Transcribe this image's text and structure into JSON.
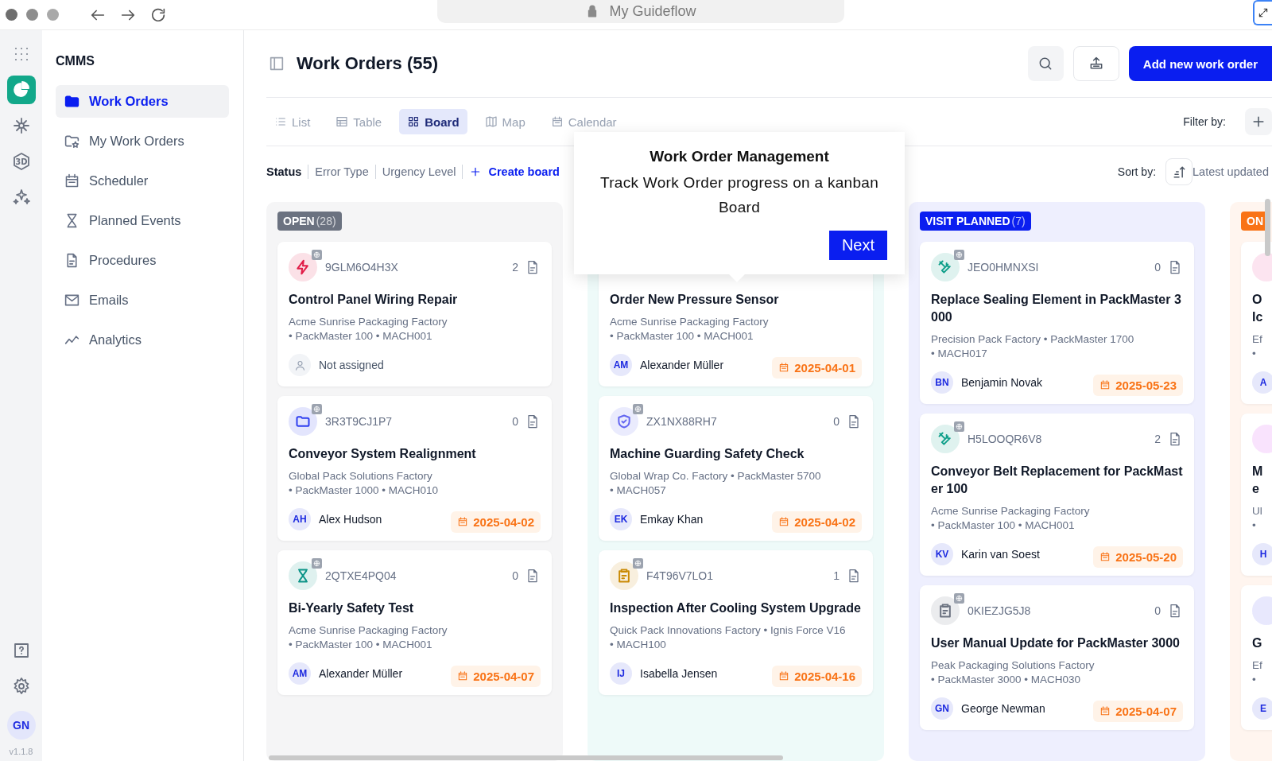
{
  "browser": {
    "address": "My Guideflow"
  },
  "rail": {
    "items": [
      {
        "kind": "grid",
        "selected": false
      },
      {
        "kind": "pie",
        "selected": true
      },
      {
        "kind": "network",
        "selected": false
      },
      {
        "kind": "cube",
        "label": "3D",
        "selected": false
      },
      {
        "kind": "sparkles",
        "selected": false
      }
    ],
    "bottom_items": [
      {
        "kind": "help"
      },
      {
        "kind": "settings"
      }
    ],
    "user_initials": "GN",
    "version": "v1.1.8"
  },
  "sidebar": {
    "title": "CMMS",
    "items": [
      {
        "label": "Work Orders",
        "selected": true
      },
      {
        "label": "My Work Orders",
        "selected": false
      },
      {
        "label": "Scheduler",
        "selected": false
      },
      {
        "label": "Planned Events",
        "selected": false
      },
      {
        "label": "Procedures",
        "selected": false
      },
      {
        "label": "Emails",
        "selected": false
      },
      {
        "label": "Analytics",
        "selected": false
      }
    ]
  },
  "header": {
    "title": "Work Orders (55)",
    "primary_button": "Add new work order"
  },
  "view_tabs": [
    {
      "label": "List",
      "selected": false
    },
    {
      "label": "Table",
      "selected": false
    },
    {
      "label": "Board",
      "selected": true
    },
    {
      "label": "Map",
      "selected": false
    },
    {
      "label": "Calendar",
      "selected": false
    }
  ],
  "filter": {
    "label": "Filter by:"
  },
  "group_tabs": [
    {
      "label": "Status",
      "selected": true
    },
    {
      "label": "Error Type",
      "selected": false
    },
    {
      "label": "Urgency Level",
      "selected": false
    }
  ],
  "create_board": "Create board",
  "sort": {
    "label": "Sort by:",
    "value": "Latest updated"
  },
  "columns": [
    {
      "label": "OPEN",
      "count": "(28)",
      "color": "#6b7280",
      "cards": [
        {
          "kind": "bolt",
          "color": "#e11d48",
          "id": "9GLM6O4H3X",
          "files": "2",
          "title": "Control Panel Wiring Repair",
          "location": [
            "Acme Sunrise Packaging Factory",
            "• PackMaster 100 • MACH001"
          ],
          "assignee": {
            "kind": "none",
            "name": "Not assigned"
          }
        },
        {
          "kind": "folder",
          "color": "#2f3ff0",
          "id": "3R3T9CJ1P7",
          "files": "0",
          "title": "Conveyor System Realignment",
          "location": [
            "Global Pack Solutions Factory",
            "• PackMaster 1000 • MACH010"
          ],
          "assignee": {
            "kind": "user",
            "initials": "AH",
            "name": "Alex Hudson"
          },
          "due": "2025-04-02"
        },
        {
          "kind": "hourglass",
          "color": "#0d9488",
          "id": "2QTXE4PQ04",
          "files": "0",
          "title": "Bi-Yearly Safety Test",
          "location": [
            "Acme Sunrise Packaging Factory",
            "• PackMaster 100 • MACH001"
          ],
          "assignee": {
            "kind": "user",
            "initials": "AM",
            "name": "Alexander Müller"
          },
          "due": "2025-04-07"
        }
      ]
    },
    {
      "cards": [
        {
          "kind": "plain",
          "title": "Order New Pressure Sensor",
          "location": [
            "Acme Sunrise Packaging Factory",
            "• PackMaster 100 • MACH001"
          ],
          "assignee": {
            "kind": "user",
            "initials": "AM",
            "name": "Alexander Müller"
          },
          "due": "2025-04-01"
        },
        {
          "kind": "shield",
          "color": "#6366f1",
          "id": "ZX1NX88RH7",
          "files": "0",
          "title": "Machine Guarding Safety Check",
          "location": [
            "Global Wrap Co. Factory • PackMaster 5700",
            "• MACH057"
          ],
          "assignee": {
            "kind": "user",
            "initials": "EK",
            "name": "Emkay Khan"
          },
          "due": "2025-04-02"
        },
        {
          "kind": "clipboard",
          "color": "#ca8a04",
          "id": "F4T96V7LO1",
          "files": "1",
          "title": "Inspection After Cooling System Upgrade",
          "location": [
            "Quick Pack Innovations Factory • Ignis Force V16",
            "• MACH100"
          ],
          "assignee": {
            "kind": "user",
            "initials": "IJ",
            "name": "Isabella Jensen"
          },
          "due": "2025-04-16"
        }
      ]
    },
    {
      "label": "VISIT PLANNED",
      "count": "(7)",
      "color": "#0a1ef0",
      "cards": [
        {
          "kind": "wrench",
          "color": "#0f9f8a",
          "id": "JEO0HMNXSI",
          "files": "0",
          "title": "Replace Sealing Element in PackMaster 3000",
          "location": [
            "Precision Pack Factory • PackMaster 1700",
            "• MACH017"
          ],
          "assignee": {
            "kind": "user",
            "initials": "BN",
            "name": "Benjamin Novak"
          },
          "due": "2025-05-23"
        },
        {
          "kind": "wrench",
          "color": "#0f9f8a",
          "id": "H5LOOQR6V8",
          "files": "2",
          "title": "Conveyor Belt Replacement for PackMaster 100",
          "location": [
            "Acme Sunrise Packaging Factory",
            "• PackMaster 100 • MACH001"
          ],
          "assignee": {
            "kind": "user",
            "initials": "KV",
            "name": "Karin van Soest"
          },
          "due": "2025-05-20"
        },
        {
          "kind": "clipboard",
          "color": "#6b7280",
          "id": "0KIEZJG5J8",
          "files": "0",
          "title": "User Manual Update for PackMaster 3000",
          "location": [
            "Peak Packaging Solutions Factory",
            "• PackMaster 3000 • MACH030"
          ],
          "assignee": {
            "kind": "user",
            "initials": "GN",
            "name": "George Newman"
          },
          "due": "2025-04-07"
        }
      ]
    },
    {
      "label": "ON",
      "color": "#f97316",
      "cards": [
        {
          "kind": "partial",
          "title_lines": [
            "O",
            "Ic"
          ],
          "detail_lines": [
            "Ef",
            "•"
          ],
          "initial": "A"
        },
        {
          "kind": "partial",
          "title_lines": [
            "M",
            "e"
          ],
          "detail_lines": [
            "Ul",
            "•"
          ],
          "initial": "H"
        },
        {
          "kind": "partial",
          "title_lines": [
            "G"
          ],
          "detail_lines": [
            "Ef",
            "•"
          ],
          "initial": "E"
        }
      ]
    }
  ],
  "tour": {
    "title": "Work Order Management",
    "text": "Track Work Order progress on a kanban Board",
    "button": "Next"
  }
}
